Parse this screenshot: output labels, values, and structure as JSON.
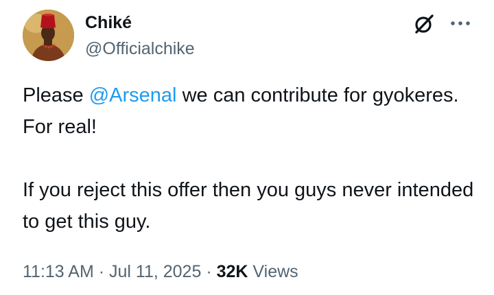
{
  "author": {
    "display_name": "Chiké",
    "handle": "@Officialchike",
    "avatar_icon": "profile-photo-red-fez"
  },
  "header_icons": {
    "grok": "grok-slash-icon",
    "more": "more-dots-icon"
  },
  "tweet": {
    "line1_prefix": "Please ",
    "mention": "@Arsenal",
    "line1_suffix": " we can contribute for gyokeres. For real!",
    "paragraph2": "If you reject this offer then you guys never intended to get this guy."
  },
  "meta": {
    "time": "11:13 AM",
    "separator1": " · ",
    "date": "Jul 11, 2025",
    "separator2": " · ",
    "views_count": "32K",
    "views_label": " Views"
  },
  "colors": {
    "text": "#0f1419",
    "secondary": "#536471",
    "link": "#1d9bf0"
  }
}
